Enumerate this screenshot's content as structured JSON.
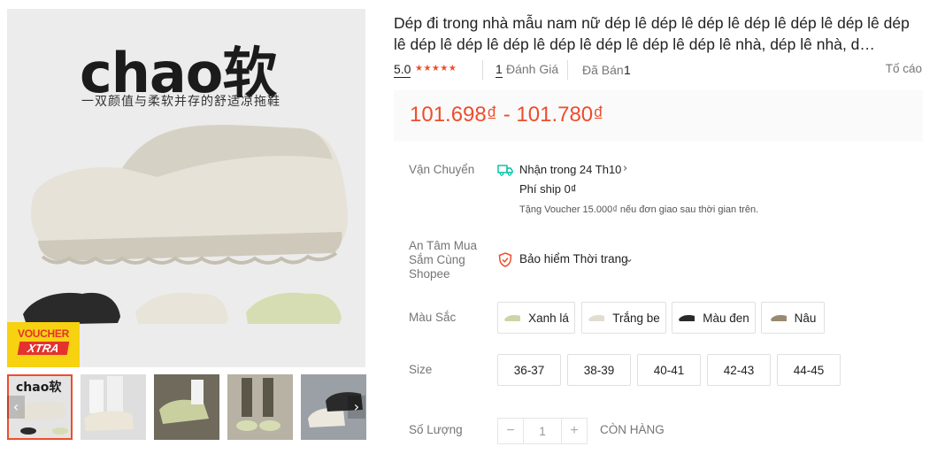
{
  "gallery": {
    "brand_text": "chao软",
    "brand_subtext": "一双颜值与柔软并存的舒适凉拖鞋",
    "voucher_line1": "VOUCHER",
    "voucher_line2": "XTRA",
    "thumb_brand": "chao软",
    "prev_icon": "chevron-left-icon",
    "next_icon": "chevron-right-icon"
  },
  "product": {
    "title": "Dép đi trong nhà mẫu nam nữ dép lê dép lê dép lê dép lê dép lê dép lê dép lê dép lê dép lê dép lê dép lê dép lê dép lê dép lê nhà, dép lê nhà, d…",
    "rating": "5.0",
    "stars": "★★★★★",
    "review_count": "1",
    "review_label": "Đánh Giá",
    "sold_label": "Đã Bán",
    "sold_count": "1",
    "report_label": "Tố cáo",
    "price": "101.698₫ - 101.780₫",
    "accent_color": "#ee4d2d"
  },
  "shipping": {
    "label": "Vận Chuyển",
    "icon": "truck-icon",
    "delivery": "Nhận trong 24 Th10",
    "fee": "Phí ship 0₫",
    "voucher_note": "Tặng Voucher 15.000₫ nếu đơn giao sau thời gian trên."
  },
  "assurance": {
    "label": "An Tâm Mua Sắm Cùng Shopee",
    "icon": "shield-icon",
    "value": "Bảo hiểm Thời trang"
  },
  "colors": {
    "label": "Màu Sắc",
    "options": [
      {
        "label": "Xanh lá",
        "swatch": "#cfd3a8"
      },
      {
        "label": "Trắng be",
        "swatch": "#e3ddd0"
      },
      {
        "label": "Màu đen",
        "swatch": "#2a2a2a"
      },
      {
        "label": "Nâu",
        "swatch": "#9a8a72"
      }
    ]
  },
  "sizes": {
    "label": "Size",
    "options": [
      "36-37",
      "38-39",
      "40-41",
      "42-43",
      "44-45"
    ]
  },
  "quantity": {
    "label": "Số Lượng",
    "minus": "−",
    "value": "1",
    "plus": "+",
    "stock_text": "CÒN HÀNG"
  }
}
